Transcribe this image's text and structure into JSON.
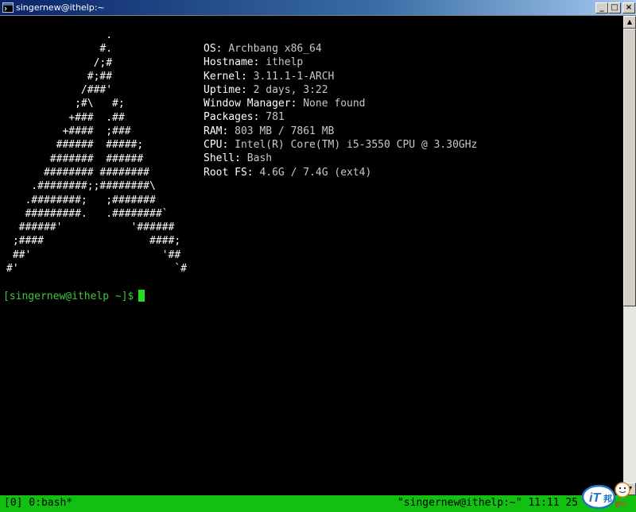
{
  "window": {
    "title": "singernew@ithelp:~",
    "minimize_glyph": "_",
    "maximize_glyph": "□",
    "close_glyph": "×"
  },
  "scrollbar": {
    "up_glyph": "▲",
    "down_glyph": "▼"
  },
  "ascii_art": "                .\n               #.\n              /;#\n             #;##\n            /###'\n           ;#\\   #;\n          +###  .##\n         +####  ;###\n        ######  #####;\n       #######  ######\n      ######## ########\n    .########;;########\\\n   .########;   ;#######\n   #########.   .########`\n  ######'           '######\n ;####                 ####;\n ##'                     '##\n#'                         `#",
  "sysinfo": [
    {
      "label": "OS: ",
      "value": "Archbang x86_64"
    },
    {
      "label": "Hostname: ",
      "value": "ithelp"
    },
    {
      "label": "Kernel: ",
      "value": "3.11.1-1-ARCH"
    },
    {
      "label": "Uptime: ",
      "value": "2 days, 3:22"
    },
    {
      "label": "Window Manager: ",
      "value": "None found"
    },
    {
      "label": "Packages: ",
      "value": "781"
    },
    {
      "label": "RAM: ",
      "value": "803 MB / 7861 MB"
    },
    {
      "label": "CPU: ",
      "value": "Intel(R) Core(TM) i5-3550 CPU @ 3.30GHz"
    },
    {
      "label": "Shell: ",
      "value": "Bash"
    },
    {
      "label": "Root FS: ",
      "value": "4.6G / 7.4G (ext4)"
    }
  ],
  "prompt": "[singernew@ithelp ~]$",
  "statusbar": {
    "left": "[0] 0:bash*",
    "right": "\"singernew@ithelp:~\" 11:11 25"
  },
  "logo": {
    "text_main": "iT",
    "text_sub": "邦",
    "text_tag": "幫忙"
  },
  "colors": {
    "titlebar_start": "#0a246a",
    "terminal_bg": "#000000",
    "prompt_green": "#3ec83e",
    "cursor_green": "#22dd22",
    "statusbar_green": "#12c012",
    "logo_blue": "#1e73c8"
  }
}
